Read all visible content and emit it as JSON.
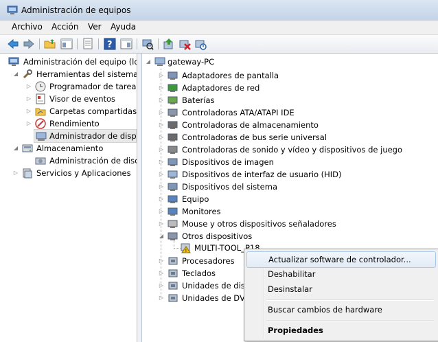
{
  "window": {
    "title": "Administración de equipos",
    "icon": "computer-management-icon"
  },
  "menubar": {
    "items": [
      "Archivo",
      "Acción",
      "Ver",
      "Ayuda"
    ]
  },
  "toolbar": {
    "buttons": [
      "back-arrow-icon",
      "forward-arrow-icon",
      "up-folder-icon",
      "show-hide-tree-icon",
      "export-list-icon",
      "help-icon",
      "show-hide-action-pane-icon",
      "scan-hardware-icon",
      "update-driver-icon",
      "uninstall-icon",
      "disable-device-icon"
    ]
  },
  "left_tree": {
    "root": "Administración del equipo (loc",
    "system_tools": "Herramientas del sistema",
    "task_scheduler": "Programador de tareas",
    "event_viewer": "Visor de eventos",
    "shared_folders": "Carpetas compartidas",
    "performance": "Rendimiento",
    "device_manager": "Administrador de dispo",
    "storage": "Almacenamiento",
    "disk_management": "Administración de disco",
    "services_apps": "Servicios y Aplicaciones"
  },
  "device_tree": {
    "root": "gateway-PC",
    "items": [
      "Adaptadores de pantalla",
      "Adaptadores de red",
      "Baterías",
      "Controladoras ATA/ATAPI IDE",
      "Controladoras de almacenamiento",
      "Controladoras de bus serie universal",
      "Controladoras de sonido y vídeo y dispositivos de juego",
      "Dispositivos de imagen",
      "Dispositivos de interfaz de usuario (HID)",
      "Dispositivos del sistema",
      "Equipo",
      "Monitores",
      "Mouse y otros dispositivos señaladores",
      "Otros dispositivos"
    ],
    "child": "MULTI-TOOL_P18",
    "after_items": [
      "Procesadores",
      "Teclados",
      "Unidades de disc",
      "Unidades de DVD"
    ]
  },
  "context_menu": {
    "update_driver": "Actualizar software de controlador...",
    "disable": "Deshabilitar",
    "uninstall": "Desinstalar",
    "scan": "Buscar cambios de hardware",
    "properties": "Propiedades"
  },
  "colors": {
    "accent": "#3b6fbf",
    "selection": "#e8e8e8",
    "highlight_border": "#a8c8ea"
  }
}
